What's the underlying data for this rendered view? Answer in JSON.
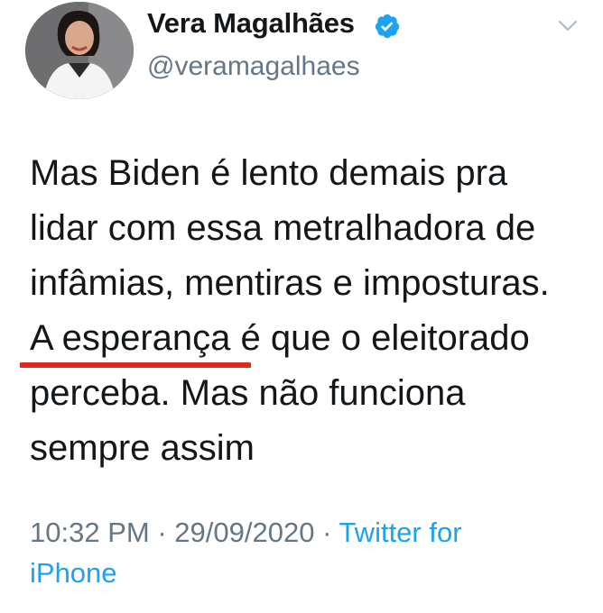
{
  "tweet": {
    "author": {
      "display_name": "Vera Magalhães",
      "handle": "@veramagalhaes",
      "verified": true,
      "avatar_icon": "profile-photo"
    },
    "more_icon": "chevron-down-icon",
    "text_lines": [
      "Mas Biden é lento demais pra",
      "lidar com essa metralhadora de",
      "infâmias, mentiras e imposturas.",
      "A esperança é que o eleitorado",
      "perceba. Mas não funciona",
      "sempre assim"
    ],
    "time": "10:32 PM",
    "separator": "·",
    "date": "29/09/2020",
    "source_line1": "Twitter for",
    "source_line2": "iPhone"
  },
  "colors": {
    "text": "#14171a",
    "secondary": "#657786",
    "link": "#1da1f2",
    "annotation_underline": "#e0281b"
  }
}
